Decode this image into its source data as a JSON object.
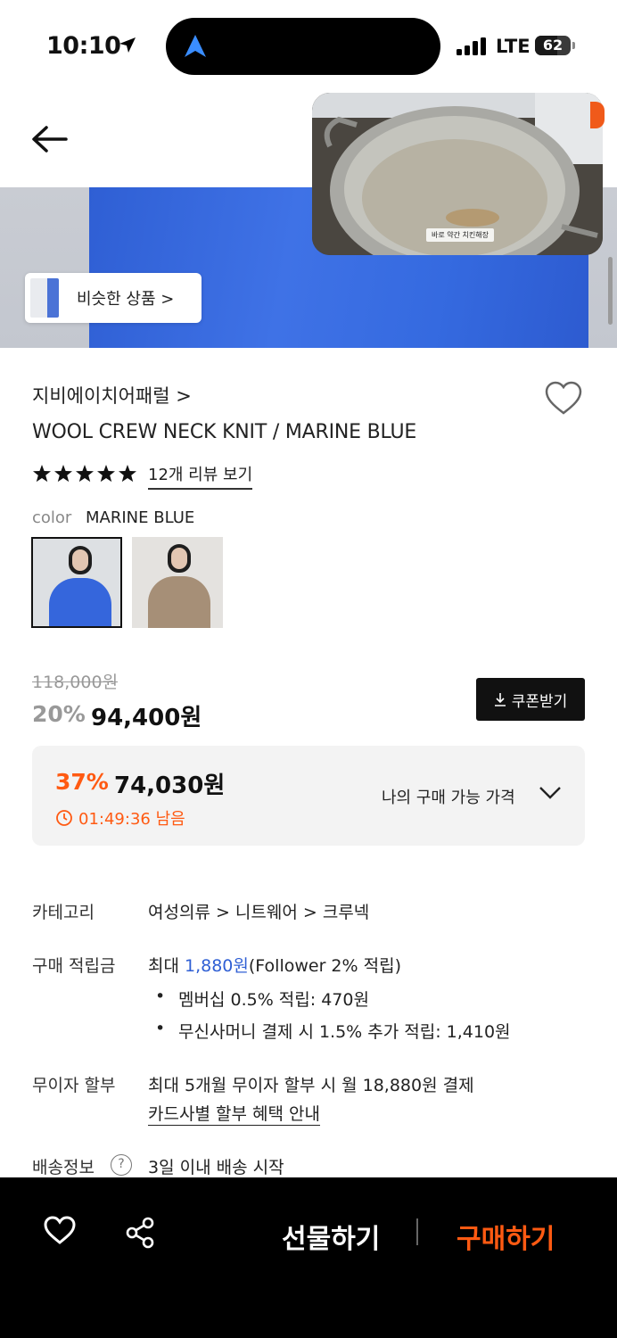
{
  "status_bar": {
    "time": "10:10",
    "network": "LTE",
    "battery": "62",
    "battery_level": 0.62
  },
  "hero": {
    "similar_label": "비슷한 상품 >",
    "pip_caption": "바로 약간 치킨해장"
  },
  "product": {
    "brand": "지비에이치어패럴 >",
    "name": "WOOL CREW NECK KNIT / MARINE BLUE",
    "rating_stars": 5,
    "review_link": "12개 리뷰 보기",
    "color_label": "color",
    "color_value": "MARINE BLUE"
  },
  "price": {
    "original": "118,000원",
    "discount": "20%",
    "sale": "94,400원",
    "coupon_label": "쿠폰받기"
  },
  "best_price": {
    "percent": "37%",
    "price": "74,030원",
    "timer": "01:49:36 남음",
    "label": "나의 구매 가능 가격"
  },
  "info": {
    "category_label": "카테고리",
    "category_value": "여성의류 > 니트웨어 > 크루넥",
    "points_label": "구매 적립금",
    "points_prefix": "최대 ",
    "points_amount": "1,880원",
    "points_suffix": "(Follower 2% 적립)",
    "points_bullet1": "멤버십 0.5% 적립: 470원",
    "points_bullet2": "무신사머니 결제 시 1.5% 추가 적립: 1,410원",
    "installment_label": "무이자 할부",
    "installment_value": "최대 5개월 무이자 할부 시 월 18,880원 결제",
    "installment_link": "카드사별 할부 혜택 안내",
    "shipping_label": "배송정보",
    "shipping_value": "3일 이내 배송 시작"
  },
  "bottom_bar": {
    "gift_label": "선물하기",
    "buy_label": "구매하기"
  },
  "colors": {
    "accent_orange": "#ff5a12",
    "link_blue": "#2f5fd4",
    "sweater_blue": "#3a6ae0"
  }
}
